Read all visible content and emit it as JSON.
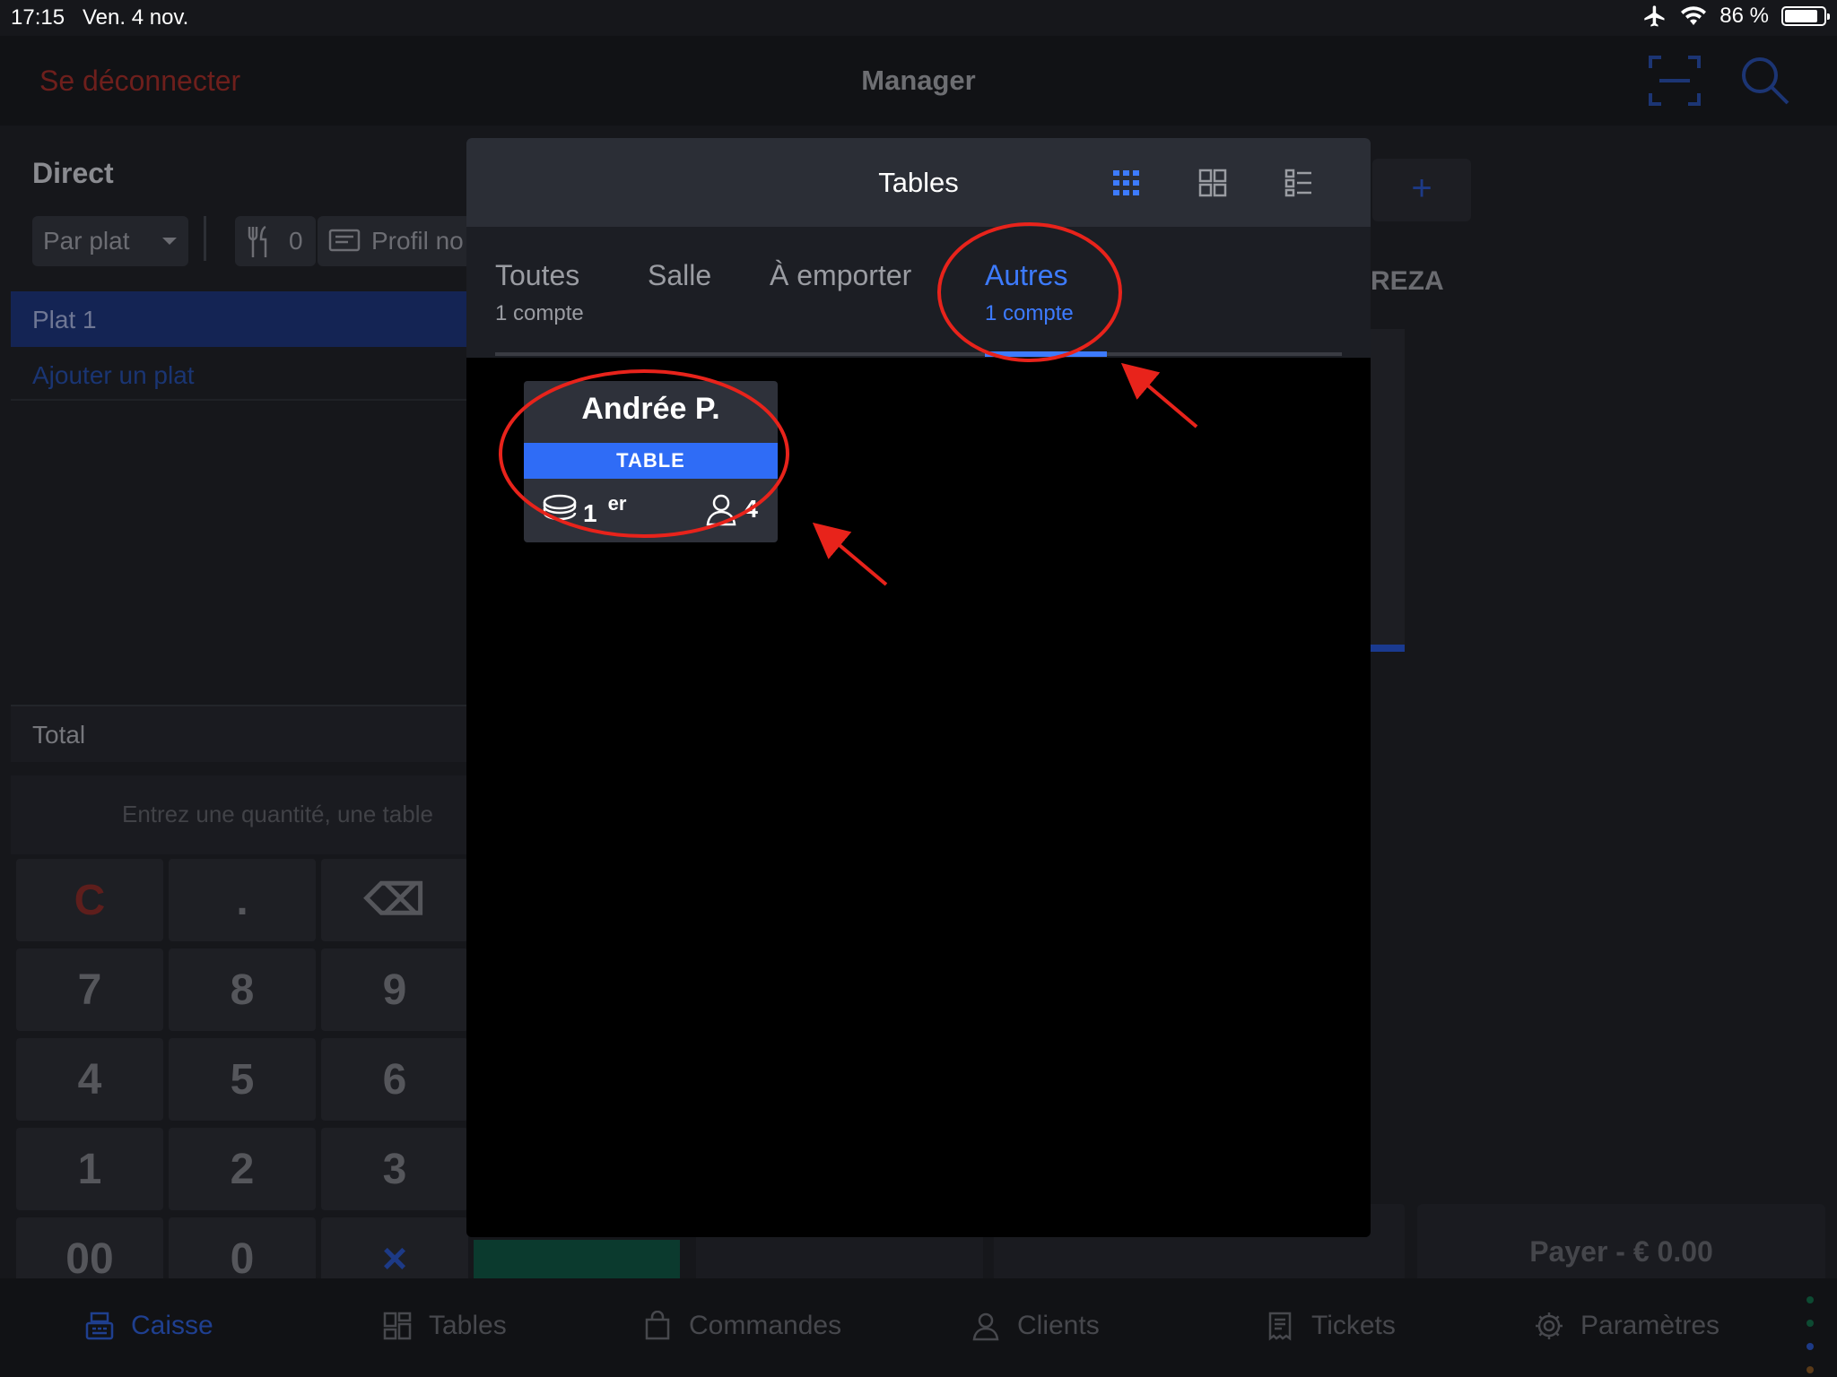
{
  "status_bar": {
    "time": "17:15",
    "date": "Ven. 4 nov.",
    "battery": "86 %",
    "battery_level": 0.86
  },
  "navbar": {
    "logout_label": "Se déconnecter",
    "title": "Manager",
    "scan_icon": "scan-icon",
    "search_icon": "search-icon"
  },
  "order_panel": {
    "title": "Direct",
    "mode_select": "Par plat",
    "covers": "0",
    "profile": "Profil no",
    "items": [
      {
        "label": "Plat 1"
      }
    ],
    "add_dish_label": "Ajouter un plat",
    "total_label": "Total",
    "quantity_placeholder": "Entrez une quantité, une table"
  },
  "keypad": {
    "keys": [
      "C",
      ".",
      "⌫",
      "7",
      "8",
      "9",
      "4",
      "5",
      "6",
      "1",
      "2",
      "3",
      "00",
      "0",
      "×"
    ]
  },
  "right_panel": {
    "customer_label": "REZA",
    "add_label": "+"
  },
  "pay_button": {
    "label": "Payer - € 0.00"
  },
  "modal": {
    "title": "Tables",
    "view_modes": [
      "grid-small-icon",
      "grid-large-icon",
      "list-icon"
    ],
    "active_view": "grid-small-icon",
    "tabs": [
      {
        "label": "Toutes",
        "count": "1 compte"
      },
      {
        "label": "Salle",
        "count": ""
      },
      {
        "label": "À emporter",
        "count": ""
      },
      {
        "label": "Autres",
        "count": "1 compte"
      }
    ],
    "active_tab": "Autres",
    "cards": [
      {
        "name": "Andrée P.",
        "type": "TABLE",
        "course": "1",
        "course_suffix": "er",
        "guests": "4"
      }
    ]
  },
  "tab_bar": {
    "items": [
      {
        "label": "Caisse",
        "icon": "register-icon"
      },
      {
        "label": "Tables",
        "icon": "tables-icon"
      },
      {
        "label": "Commandes",
        "icon": "bag-icon"
      },
      {
        "label": "Clients",
        "icon": "person-icon"
      },
      {
        "label": "Tickets",
        "icon": "receipt-icon"
      },
      {
        "label": "Paramètres",
        "icon": "gear-icon"
      }
    ],
    "active": "Caisse"
  },
  "colors": {
    "accent": "#3d7bff",
    "card_type_bg": "#2f6cf6",
    "annotation": "#e8231b",
    "modal_header": "#2b2e36"
  }
}
